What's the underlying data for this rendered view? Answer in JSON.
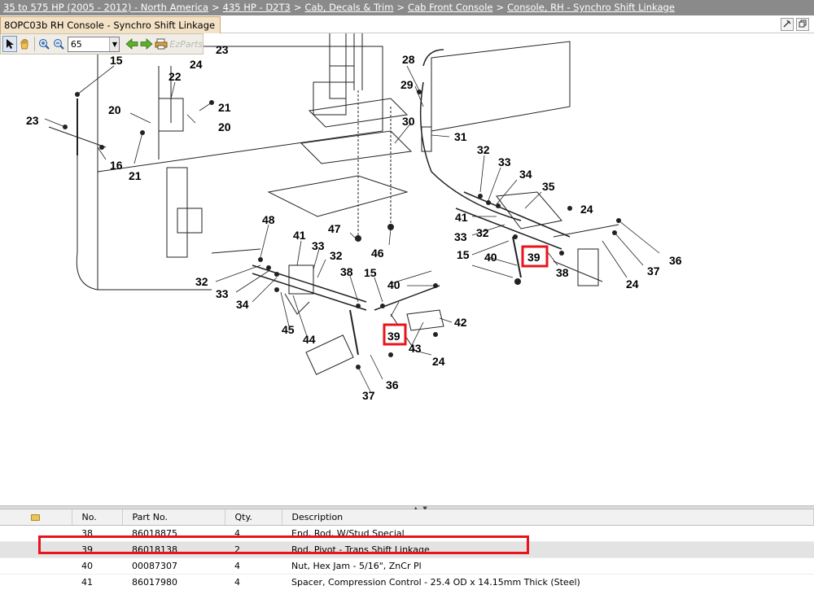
{
  "breadcrumb": {
    "items": [
      "35 to 575 HP (2005 - 2012) - North America",
      "435 HP - D2T3",
      "Cab, Decals & Trim",
      "Cab Front Console",
      "Console, RH - Synchro Shift Linkage"
    ],
    "separator": ">"
  },
  "window": {
    "title": "8OPC03b RH Console - Synchro Shift Linkage",
    "pin_icon": "pin-icon",
    "restore_icon": "restore-icon",
    "close_icon": "close-icon"
  },
  "toolbar": {
    "zoom_value": "65",
    "tools": [
      "select-arrow-icon",
      "pan-hand-icon",
      "zoom-in-icon",
      "zoom-out-icon",
      "back-arrow-icon",
      "forward-arrow-icon",
      "print-icon"
    ]
  },
  "diagram": {
    "watermark": "EzParts",
    "callouts": [
      "15",
      "24",
      "23",
      "22",
      "20",
      "21",
      "20",
      "23",
      "16",
      "21",
      "28",
      "29",
      "30",
      "31",
      "32",
      "33",
      "34",
      "35",
      "24",
      "41",
      "32",
      "33",
      "15",
      "40",
      "39",
      "38",
      "36",
      "37",
      "24",
      "48",
      "41",
      "33",
      "32",
      "32",
      "33",
      "34",
      "38",
      "15",
      "40",
      "42",
      "39",
      "43",
      "24",
      "45",
      "44",
      "36",
      "37",
      "47",
      "46"
    ],
    "highlight_callout": "39",
    "highlight_color": "#e8141c"
  },
  "parts_table": {
    "columns": [
      "",
      "No.",
      "Part No.",
      "Qty.",
      "Description"
    ],
    "rows": [
      {
        "no": "38",
        "part": "86018875",
        "qty": "4",
        "desc": "End, Rod, W/Stud Special"
      },
      {
        "no": "39",
        "part": "86018138",
        "qty": "2",
        "desc": "Rod, Pivot - Trans Shift Linkage"
      },
      {
        "no": "40",
        "part": "00087307",
        "qty": "4",
        "desc": "Nut, Hex Jam - 5/16\", ZnCr Pl"
      },
      {
        "no": "41",
        "part": "86017980",
        "qty": "4",
        "desc": "Spacer, Compression Control - 25.4 OD x 14.15mm Thick (Steel)"
      }
    ],
    "selected_row_no": "39"
  }
}
